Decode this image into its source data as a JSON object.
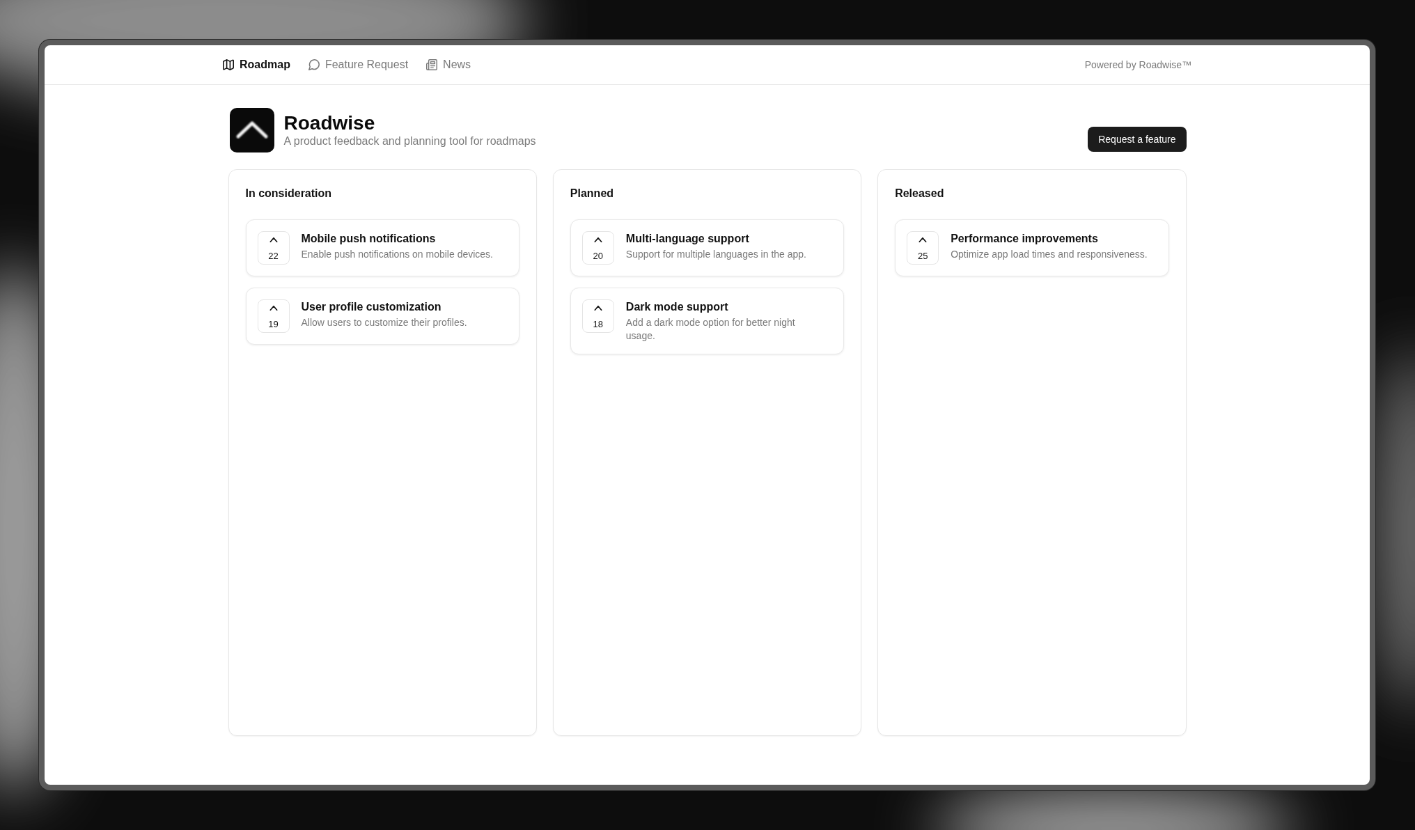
{
  "nav": {
    "items": [
      {
        "label": "Roadmap",
        "selected": true
      },
      {
        "label": "Feature Request",
        "selected": false
      },
      {
        "label": "News",
        "selected": false
      }
    ],
    "powered_by": "Powered by Roadwise™"
  },
  "header": {
    "title": "Roadwise",
    "subtitle": "A product feedback and planning tool for roadmaps",
    "action": "Request a feature"
  },
  "columns": [
    {
      "title": "In consideration",
      "cards": [
        {
          "votes": "22",
          "title": "Mobile push notifications",
          "description": "Enable push notifications on mobile devices."
        },
        {
          "votes": "19",
          "title": "User profile customization",
          "description": "Allow users to customize their profiles."
        }
      ]
    },
    {
      "title": "Planned",
      "cards": [
        {
          "votes": "20",
          "title": "Multi-language support",
          "description": "Support for multiple languages in the app."
        },
        {
          "votes": "18",
          "title": "Dark mode support",
          "description": "Add a dark mode option for better night usage."
        }
      ]
    },
    {
      "title": "Released",
      "cards": [
        {
          "votes": "25",
          "title": "Performance improvements",
          "description": "Optimize app load times and responsiveness."
        }
      ]
    }
  ]
}
